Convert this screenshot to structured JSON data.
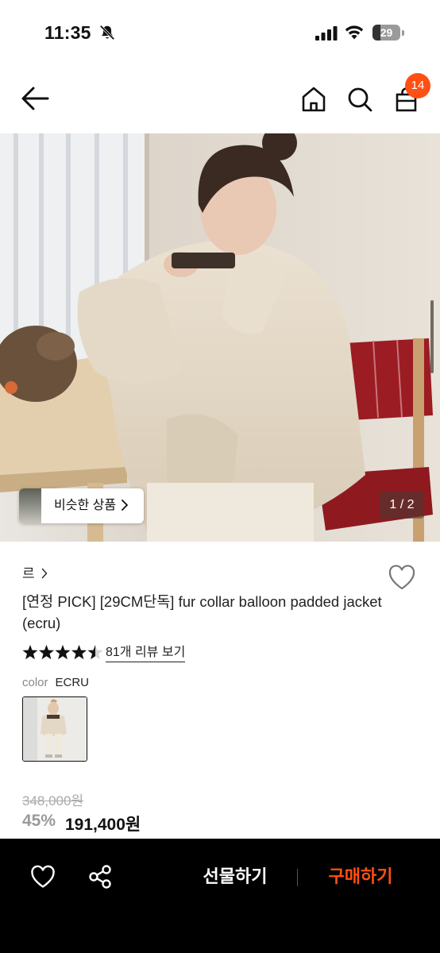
{
  "status_bar": {
    "time": "11:35",
    "battery_level": "29",
    "battery_fraction": 0.29,
    "icons": [
      "bell-slash-icon",
      "signal-icon",
      "wifi-icon",
      "battery-icon"
    ]
  },
  "header": {
    "icons": [
      "back-arrow-icon",
      "home-icon",
      "search-icon",
      "shopping-bag-icon"
    ],
    "cart_count": "14",
    "badge_color": "#ff4f12"
  },
  "gallery": {
    "similar_label": "비슷한 상품",
    "counter": "1 / 2"
  },
  "product": {
    "brand": "르",
    "title": "[연정 PICK] [29CM단독] fur collar balloon padded jacket (ecru)",
    "rating": 4.5,
    "rating_max": 5,
    "review_link": "81개 리뷰 보기",
    "color_label": "color",
    "color_value": "ECRU",
    "original_price": "348,000원",
    "discount_rate": "45%",
    "sale_price": "191,400원"
  },
  "bottom_bar": {
    "gift_label": "선물하기",
    "buy_label": "구매하기",
    "accent_color": "#ff4f12",
    "icons": [
      "heart-icon",
      "share-icon"
    ]
  }
}
